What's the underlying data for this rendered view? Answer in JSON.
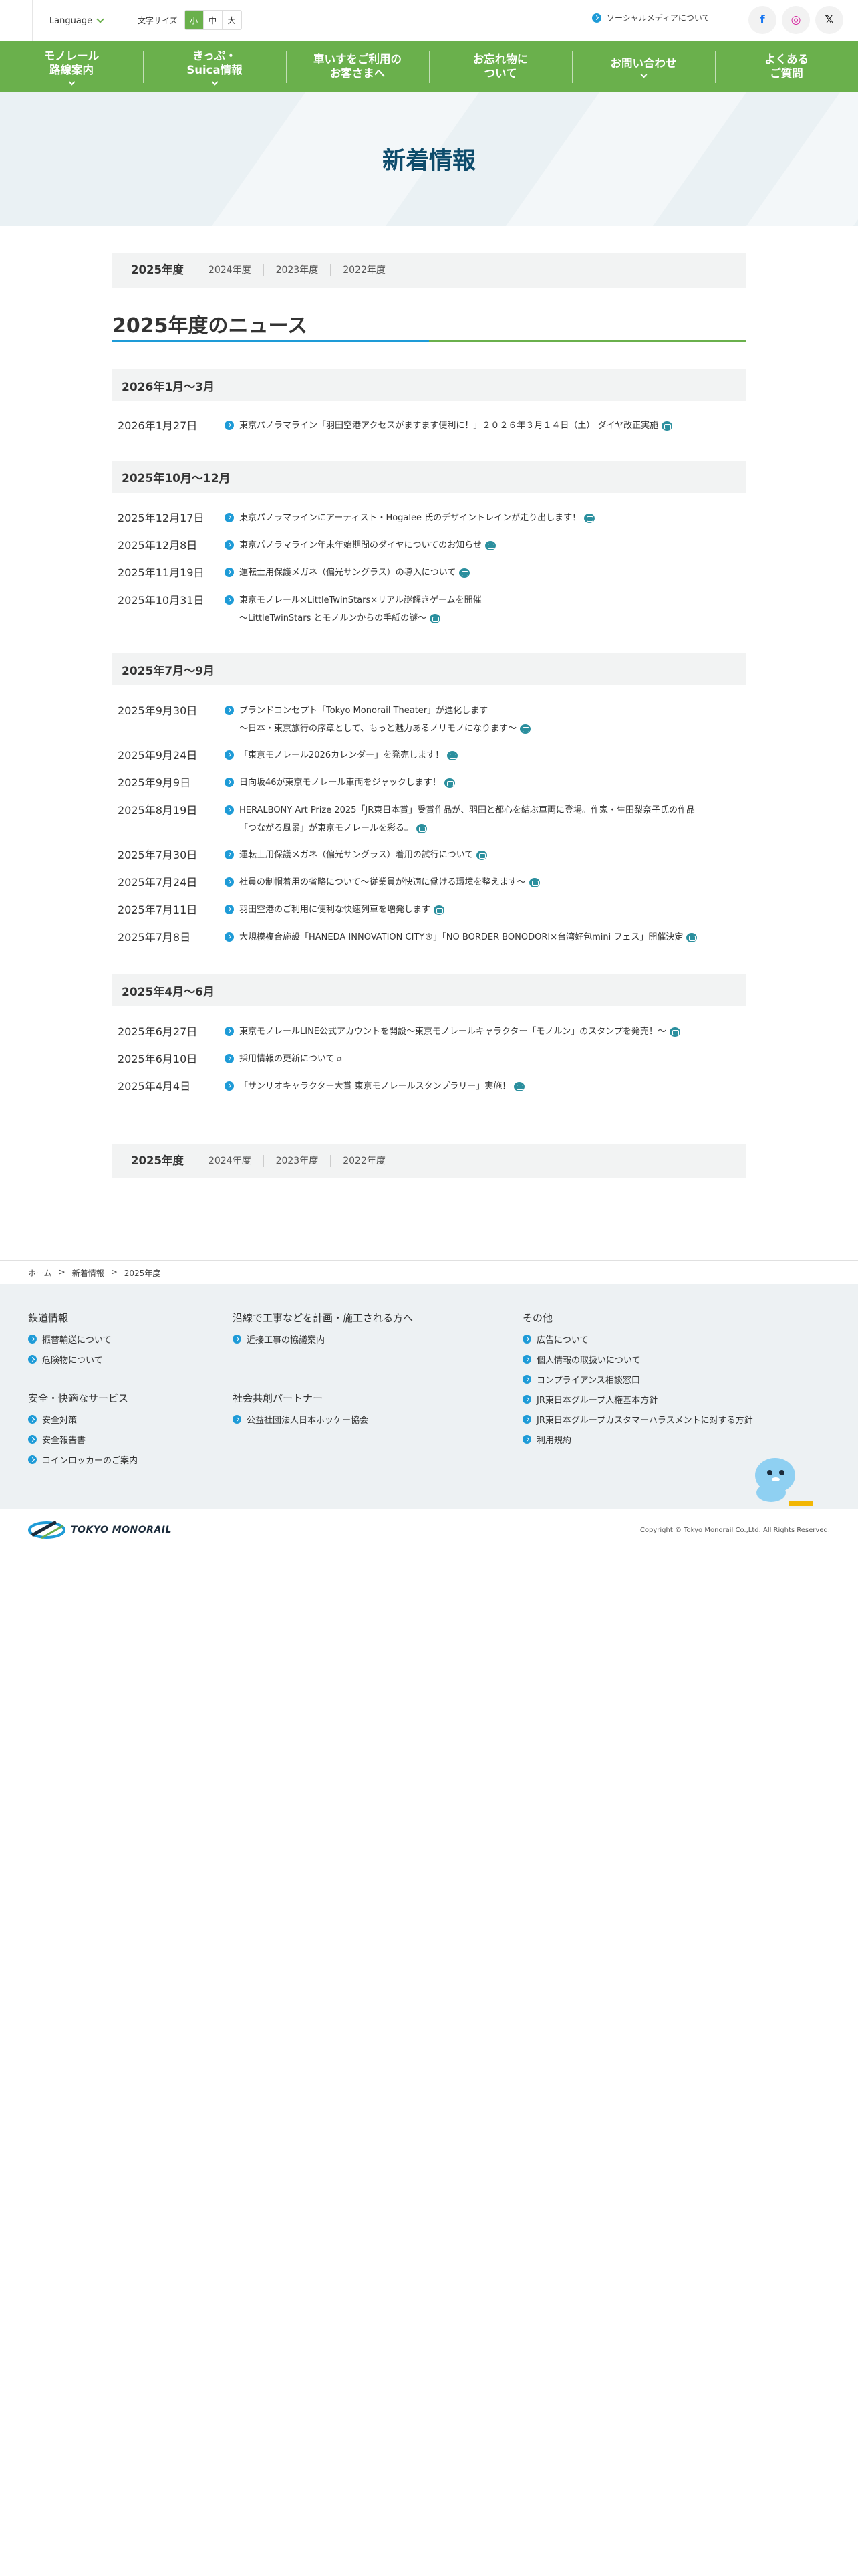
{
  "topbar": {
    "language": "Language",
    "font_size_label": "文字サイズ",
    "font_sizes": [
      "小",
      "中",
      "大"
    ],
    "social_link": "ソーシャルメディアについて",
    "sns": [
      "f",
      "◎",
      "𝕏"
    ]
  },
  "nav": [
    {
      "line1": "モノレール",
      "line2": "路線案内"
    },
    {
      "line1": "きっぷ・",
      "line2": "Suica情報"
    },
    {
      "line1": "車いすをご利用の",
      "line2": "お客さまへ"
    },
    {
      "line1": "お忘れ物に",
      "line2": "ついて"
    },
    {
      "line1": "お問い合わせ",
      "line2": ""
    },
    {
      "line1": "よくある",
      "line2": "ご質問"
    }
  ],
  "page_title": "新着情報",
  "year_tabs": [
    "2025年度",
    "2024年度",
    "2023年度",
    "2022年度"
  ],
  "section_title": "2025年度のニュース",
  "groups": [
    {
      "heading": "2026年1月〜3月",
      "items": [
        {
          "date": "2026年1月27日",
          "text": "東京パノラマライン「羽田空港アクセスがますます便利に！」２０２６年３月１４日（土） ダイヤ改正実施"
        }
      ]
    },
    {
      "heading": "2025年10月〜12月",
      "items": [
        {
          "date": "2025年12月17日",
          "text": "東京パノラマラインにアーティスト・Hogalee 氏のデザイントレインが走り出します！"
        },
        {
          "date": "2025年12月8日",
          "text": "東京パノラマライン年末年始期間のダイヤについてのお知らせ"
        },
        {
          "date": "2025年11月19日",
          "text": "運転士用保護メガネ（偏光サングラス）の導入について"
        },
        {
          "date": "2025年10月31日",
          "text": "東京モノレール×LittleTwinStars×リアル謎解きゲームを開催",
          "text2": "〜LittleTwinStars とモノルンからの手紙の謎〜"
        }
      ]
    },
    {
      "heading": "2025年7月〜9月",
      "items": [
        {
          "date": "2025年9月30日",
          "text": "ブランドコンセプト「Tokyo Monorail Theater」が進化します",
          "text2": "〜日本・東京旅行の序章として、もっと魅力あるノリモノになります〜"
        },
        {
          "date": "2025年9月24日",
          "text": "「東京モノレール2026カレンダー」を発売します！"
        },
        {
          "date": "2025年9月9日",
          "text": "日向坂46が東京モノレール車両をジャックします！"
        },
        {
          "date": "2025年8月19日",
          "text": "HERALBONY Art Prize 2025「JR東日本賞」受賞作品が、羽田と都心を結ぶ車両に登場。作家・生田梨奈子氏の作品",
          "text2": "「つながる風景」が東京モノレールを彩る。"
        },
        {
          "date": "2025年7月30日",
          "text": "運転士用保護メガネ（偏光サングラス）着用の試行について"
        },
        {
          "date": "2025年7月24日",
          "text": "社員の制帽着用の省略について〜従業員が快適に働ける環境を整えます〜"
        },
        {
          "date": "2025年7月11日",
          "text": "羽田空港のご利用に便利な快速列車を増発します"
        },
        {
          "date": "2025年7月8日",
          "text": "大規模複合施設「HANEDA INNOVATION CITY®」「NO BORDER BONODORI×台湾好包mini フェス」開催決定"
        }
      ]
    },
    {
      "heading": "2025年4月〜6月",
      "items": [
        {
          "date": "2025年6月27日",
          "text": "東京モノレールLINE公式アカウントを開設〜東京モノレールキャラクター「モノルン」のスタンプを発売！〜"
        },
        {
          "date": "2025年6月10日",
          "text": "採用情報の更新について"
        },
        {
          "date": "2025年4月4日",
          "text": "「サンリオキャラクター大賞 東京モノレールスタンプラリー」実施！"
        }
      ]
    }
  ],
  "breadcrumb": [
    "ホーム",
    ">",
    "新着情報",
    ">",
    "2025年度"
  ],
  "footer": {
    "col1_title": "鉄道情報",
    "col1": [
      "振替輸送について",
      "危険物について"
    ],
    "col1b_title": "安全・快適なサービス",
    "col1b": [
      "安全対策",
      "安全報告書",
      "コインロッカーのご案内"
    ],
    "col2_title": "沿線で工事などを計画・施工される方へ",
    "col2": [
      "近接工事の協議案内"
    ],
    "col2b_title": "社会共創パートナー",
    "col2b": [
      "公益社団法人日本ホッケー協会"
    ],
    "col3_title": "その他",
    "col3": [
      "広告について",
      "個人情報の取扱いについて",
      "コンプライアンス相談窓口",
      "JR東日本グループ人権基本方針",
      "JR東日本グループカスタマーハラスメントに対する方針",
      "利用規約"
    ],
    "logo_text": "TOKYO MONORAIL",
    "copyright": "Copyright © Tokyo Monorail Co.,Ltd. All Rights Reserved."
  },
  "colors": {
    "green": "#6ab04c",
    "blue": "#1e9bd7",
    "title": "#0e4c6c"
  }
}
